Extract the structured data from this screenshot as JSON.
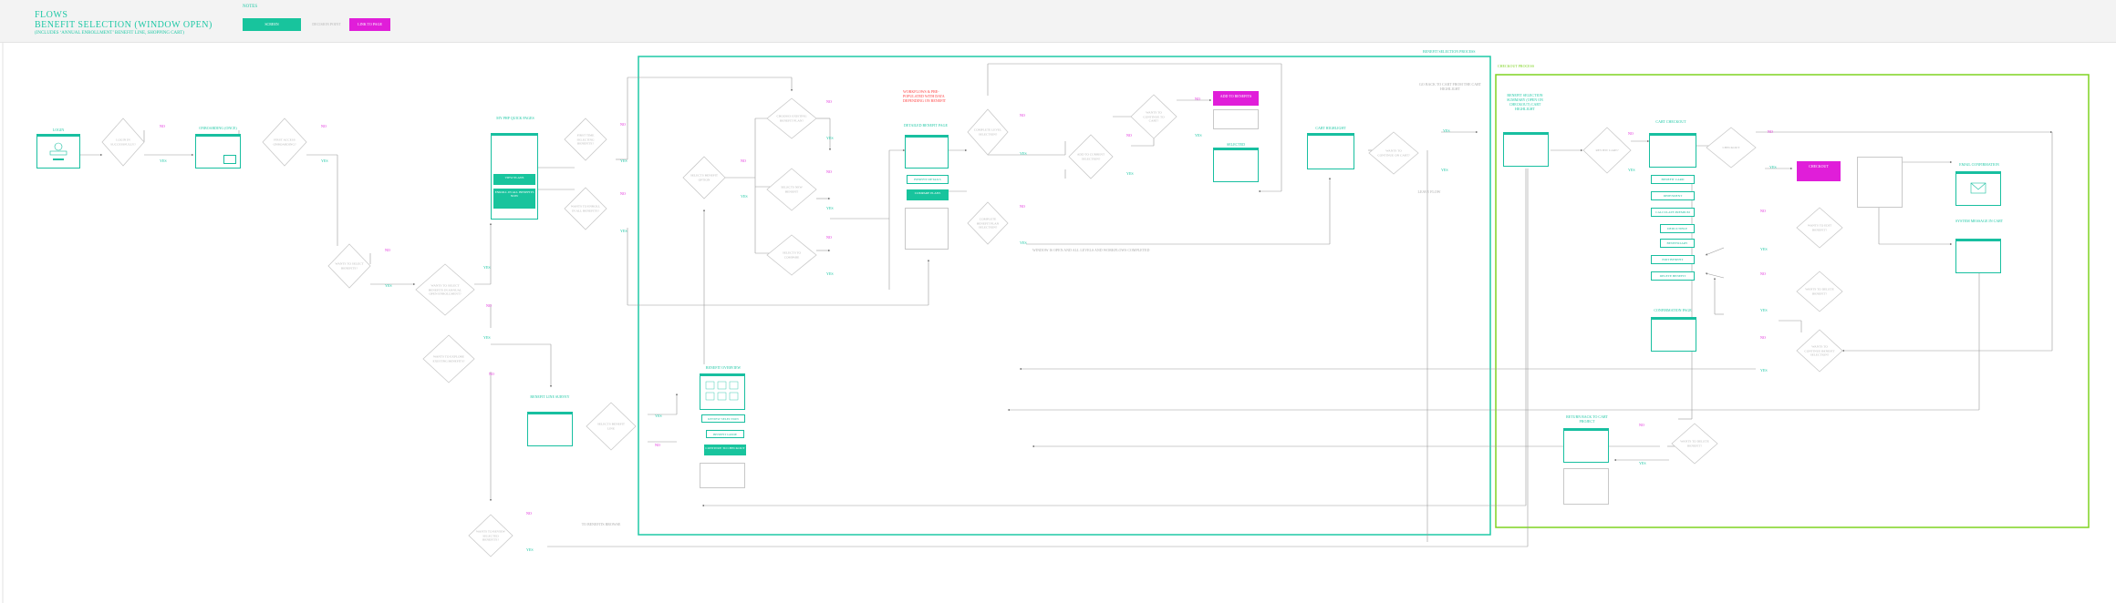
{
  "header": {
    "notes_label": "NOTES",
    "flows_label": "FLOWS",
    "title": "BENEFIT SELECTION (WINDOW OPEN)",
    "subtitle": "(INCLUDES ‘ANNUAL ENROLLMENT’ BENEFIT LINE, SHOPPING CART)",
    "legend": {
      "screen": "SCREEN",
      "decision": "DECISION POINT",
      "link": "LINK TO PAGE"
    }
  },
  "colors": {
    "teal": "#1fc8a6",
    "magenta": "#e01ed9",
    "lime": "#7ed321",
    "grey": "#b5b5b5"
  },
  "sections": {
    "benefit_selection": "BENEFIT SELECTION PROCESS",
    "checkout": "CHECKOUT PROCESS"
  },
  "screens": {
    "login": "LOGIN",
    "onboarding": "ONBOARDING (ONCE)",
    "summary": "MY PHP QUICK PAGES",
    "benefit_line": "BENEFIT LINE SURVEY",
    "benefit_overview": "BENEFIT OVERVIEW",
    "detailed": "DETAILED BENEFIT PAGE",
    "cart_highlight": "CART HIGHLIGHT",
    "benefit_selection_step": "BENEFIT SELECTION SUMMARY (OPEN ON CHECKOUT) CART HIGHLIGHT",
    "cart_checkout": "CART CHECKOUT",
    "selected": "SELECTED",
    "confirmation": "CONFIRMATION PAGE",
    "email_confirm": "EMAIL CONFIRMATION",
    "system_message": "SYSTEM MESSAGE IN CART",
    "return_to_cart": "RETURN BACK TO CART PROJECT"
  },
  "buttons": {
    "summary_1": "VIEW PLANS",
    "summary_2": "ENROLL IN ALL BENEFITS NOW",
    "detailed_1": "BENEFIT DETAILS",
    "detailed_2": "COMPARE PLANS",
    "overview_1": "REVIEW SELECTION",
    "overview_2": "BENEFIT GUIDE",
    "overview_3": "CONTINUE TO CHECKOUT",
    "add_to_benefits": "ADD TO BENEFITS",
    "cart_list_1": "BENEFIT CARD",
    "cart_list_2": "DEPENDENT",
    "cart_list_3": "CALCULATE PREMIUM",
    "cart_list_4": "DEDUCTIBLE",
    "cart_list_5": "BENEFICIARY",
    "cart_list_6": "EDIT BENEFIT",
    "cart_list_7": "DELETE BENEFIT",
    "checkout_btn": "CHECKOUT"
  },
  "decisions": {
    "d1": "LOGIN IN SUCCESSFULLY?",
    "d2": "FIRST ACCESS ONBOARDING?",
    "d3": "WANTS TO SELECT BENEFITS?",
    "d4": "WANTS TO SELECT BENEFITS IN ANNUAL OPEN ENROLLMENT?",
    "d5": "WANTS TO EXPLORE EXISTING BENEFITS?",
    "d6": "WANTS TO REVIEW SELECTED BENEFITS?",
    "d7": "FIRST TIME SELECTING BENEFITS?",
    "d8": "WANTS TO ENROLL IN ALL BENEFITS?",
    "d9": "SELECTS BENEFIT LINE",
    "d10": "SELECTS BENEFIT OPTION",
    "d11": "CHOOSES EXISTING BENEFIT PLAN?",
    "d12": "SELECTS NEW BENEFIT",
    "d13": "SELECTS TO COMPARE",
    "d14": "COMPLETE LEVEL SELECTION?",
    "d15": "COMPLETE BENEFIT PLAN SELECTION?",
    "d16": "ADD TO CURRENT SELECTION?",
    "d17": "WANTS TO CONTINUE TO CART?",
    "d18": "WANTS TO CONTINUE ON CART?",
    "d19": "REVIEW CART?",
    "d20": "CHECKOUT",
    "d21": "WANTS TO EDIT BENEFIT?",
    "d22": "WANTS TO DELETE BENEFIT?",
    "d23": "WANTS TO CONTINUE BENEFIT SELECTION?",
    "d24": "WANTS TO DELETE BENEFIT?"
  },
  "flow_notes": {
    "warning": "WORKFLOWS & PRE-POPULATED WITH DATA DEPENDING ON BENEFIT",
    "window": "WINDOW IS OPEN AND ALL LEVELS AND WORKFLOWS COMPLETED",
    "next_step": "TO NEXT STEP IN CART",
    "go_back": "GO BACK TO CART FROM THE CART HIGHLIGHT",
    "leave": "LEAVE FLOW",
    "browse": "TO BENEFITS BROWSE",
    "yes": "YES",
    "no": "NO"
  }
}
